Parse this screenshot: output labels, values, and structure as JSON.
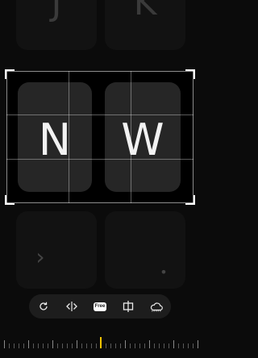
{
  "keyboard": {
    "top_keys": [
      "J",
      "K"
    ],
    "crop_keys": [
      "N",
      "W"
    ],
    "side_glyph": "›",
    "dot_glyph": "•"
  },
  "toolbar": {
    "tools": [
      {
        "name": "rotate",
        "icon": "rotate-icon"
      },
      {
        "name": "flip-horizontal",
        "icon": "flip-horizontal-icon"
      },
      {
        "name": "free-aspect",
        "icon": "free-aspect-icon",
        "label": "Free"
      },
      {
        "name": "crop-ratio",
        "icon": "crop-ratio-icon"
      },
      {
        "name": "eraser",
        "icon": "eraser-icon"
      }
    ]
  },
  "colors": {
    "background": "#0b0b0b",
    "toolbar": "#1d1d1d",
    "dial_indicator": "#f5c400"
  }
}
